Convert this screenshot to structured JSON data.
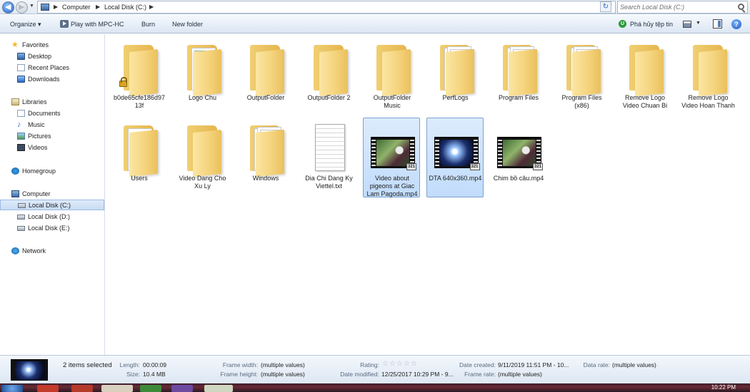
{
  "address": {
    "crumbs": [
      "Computer",
      "Local Disk (C:)"
    ],
    "search_placeholder": "Search Local Disk (C:)"
  },
  "toolbar": {
    "organize": "Organize ▾",
    "play": "Play with MPC-HC",
    "burn": "Burn",
    "new_folder": "New folder",
    "right_action": "Phá hủy tệp tin"
  },
  "sidebar": {
    "favorites": "Favorites",
    "desktop": "Desktop",
    "recent": "Recent Places",
    "downloads": "Downloads",
    "libraries": "Libraries",
    "documents": "Documents",
    "music": "Music",
    "pictures": "Pictures",
    "videos": "Videos",
    "homegroup": "Homegroup",
    "computer": "Computer",
    "disk_c": "Local Disk (C:)",
    "disk_d": "Local Disk (D:)",
    "disk_e": "Local Disk (E:)",
    "network": "Network"
  },
  "files": [
    {
      "name": "b0de65cfe186d9713f",
      "kind": "locked-folder"
    },
    {
      "name": "Logo Chu",
      "kind": "logo-folder"
    },
    {
      "name": "OutputFolder",
      "kind": "folder"
    },
    {
      "name": "OutputFolder 2",
      "kind": "folder"
    },
    {
      "name": "OutputFolder Music",
      "kind": "folder"
    },
    {
      "name": "PerfLogs",
      "kind": "folder-papers"
    },
    {
      "name": "Program Files",
      "kind": "folder-papers"
    },
    {
      "name": "Program Files (x86)",
      "kind": "folder-papers"
    },
    {
      "name": "Remove Logo Video Chuan Bi",
      "kind": "folder"
    },
    {
      "name": "Remove Logo Video Hoan Thanh",
      "kind": "folder"
    },
    {
      "name": "Users",
      "kind": "folder-paper"
    },
    {
      "name": "Video Dang Cho Xu Ly",
      "kind": "folder"
    },
    {
      "name": "Windows",
      "kind": "folder-papers"
    },
    {
      "name": "Dia Chi Dang Ky Viettel.txt",
      "kind": "txt"
    },
    {
      "name": "Video about pigeons at Giac Lam Pagoda.mp4",
      "kind": "video-garden",
      "selected": true
    },
    {
      "name": "DTA 640x360.mp4",
      "kind": "video-space",
      "selected": true
    },
    {
      "name": "Chim bồ câu.mp4",
      "kind": "video-garden"
    }
  ],
  "details": {
    "count": "2 items selected",
    "length_label": "Length:",
    "length_value": "00:00:09",
    "size_label": "Size:",
    "size_value": "10.4 MB",
    "fw_label": "Frame width:",
    "fw_value": "(multiple values)",
    "fh_label": "Frame height:",
    "fh_value": "(multiple values)",
    "rating_label": "Rating:",
    "rating_stars": 0,
    "dm_label": "Date modified:",
    "dm_value": "12/25/2017 10:29 PM - 9...",
    "dc_label": "Date created:",
    "dc_value": "9/11/2019 11:51 PM - 10...",
    "fr_label": "Frame rate:",
    "fr_value": "(multiple values)",
    "dr_label": "Data rate:",
    "dr_value": "(multiple values)"
  },
  "taskbar": {
    "clock": "10:22 PM"
  }
}
